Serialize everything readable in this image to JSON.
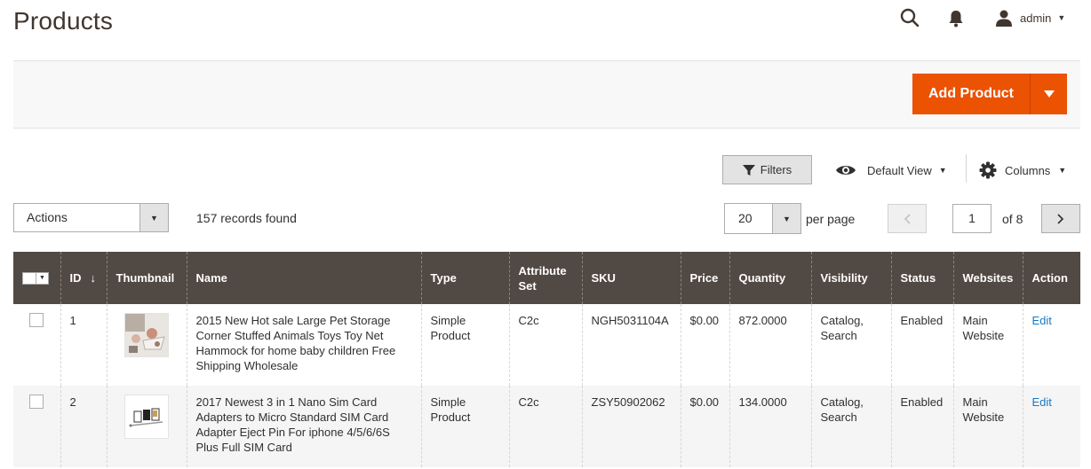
{
  "page": {
    "title": "Products"
  },
  "header": {
    "user_name": "admin"
  },
  "toolbar": {
    "add_product_label": "Add Product"
  },
  "controls": {
    "filters_label": "Filters",
    "view_label": "Default View",
    "columns_label": "Columns",
    "actions_label": "Actions",
    "records_found": "157 records found",
    "per_page_value": "20",
    "per_page_label": "per page",
    "current_page": "1",
    "total_pages_label": "of 8"
  },
  "grid": {
    "columns": [
      "ID",
      "Thumbnail",
      "Name",
      "Type",
      "Attribute Set",
      "SKU",
      "Price",
      "Quantity",
      "Visibility",
      "Status",
      "Websites",
      "Action"
    ],
    "rows": [
      {
        "id": "1",
        "name": "2015 New Hot sale Large Pet Storage Corner Stuffed Animals Toys Toy Net Hammock for home baby children Free Shipping Wholesale",
        "type": "Simple Product",
        "attribute_set": "C2c",
        "sku": "NGH5031104A",
        "price": "$0.00",
        "quantity": "872.0000",
        "visibility": "Catalog, Search",
        "status": "Enabled",
        "websites": "Main Website",
        "action": "Edit"
      },
      {
        "id": "2",
        "name": "2017 Newest 3 in 1 Nano Sim Card Adapters to Micro Standard SIM Card Adapter Eject Pin For iphone 4/5/6/6S Plus Full SIM Card",
        "type": "Simple Product",
        "attribute_set": "C2c",
        "sku": "ZSY50902062",
        "price": "$0.00",
        "quantity": "134.0000",
        "visibility": "Catalog, Search",
        "status": "Enabled",
        "websites": "Main Website",
        "action": "Edit"
      }
    ]
  },
  "colors": {
    "accent": "#eb5202",
    "header_bg": "#514943",
    "link": "#1979c3"
  }
}
